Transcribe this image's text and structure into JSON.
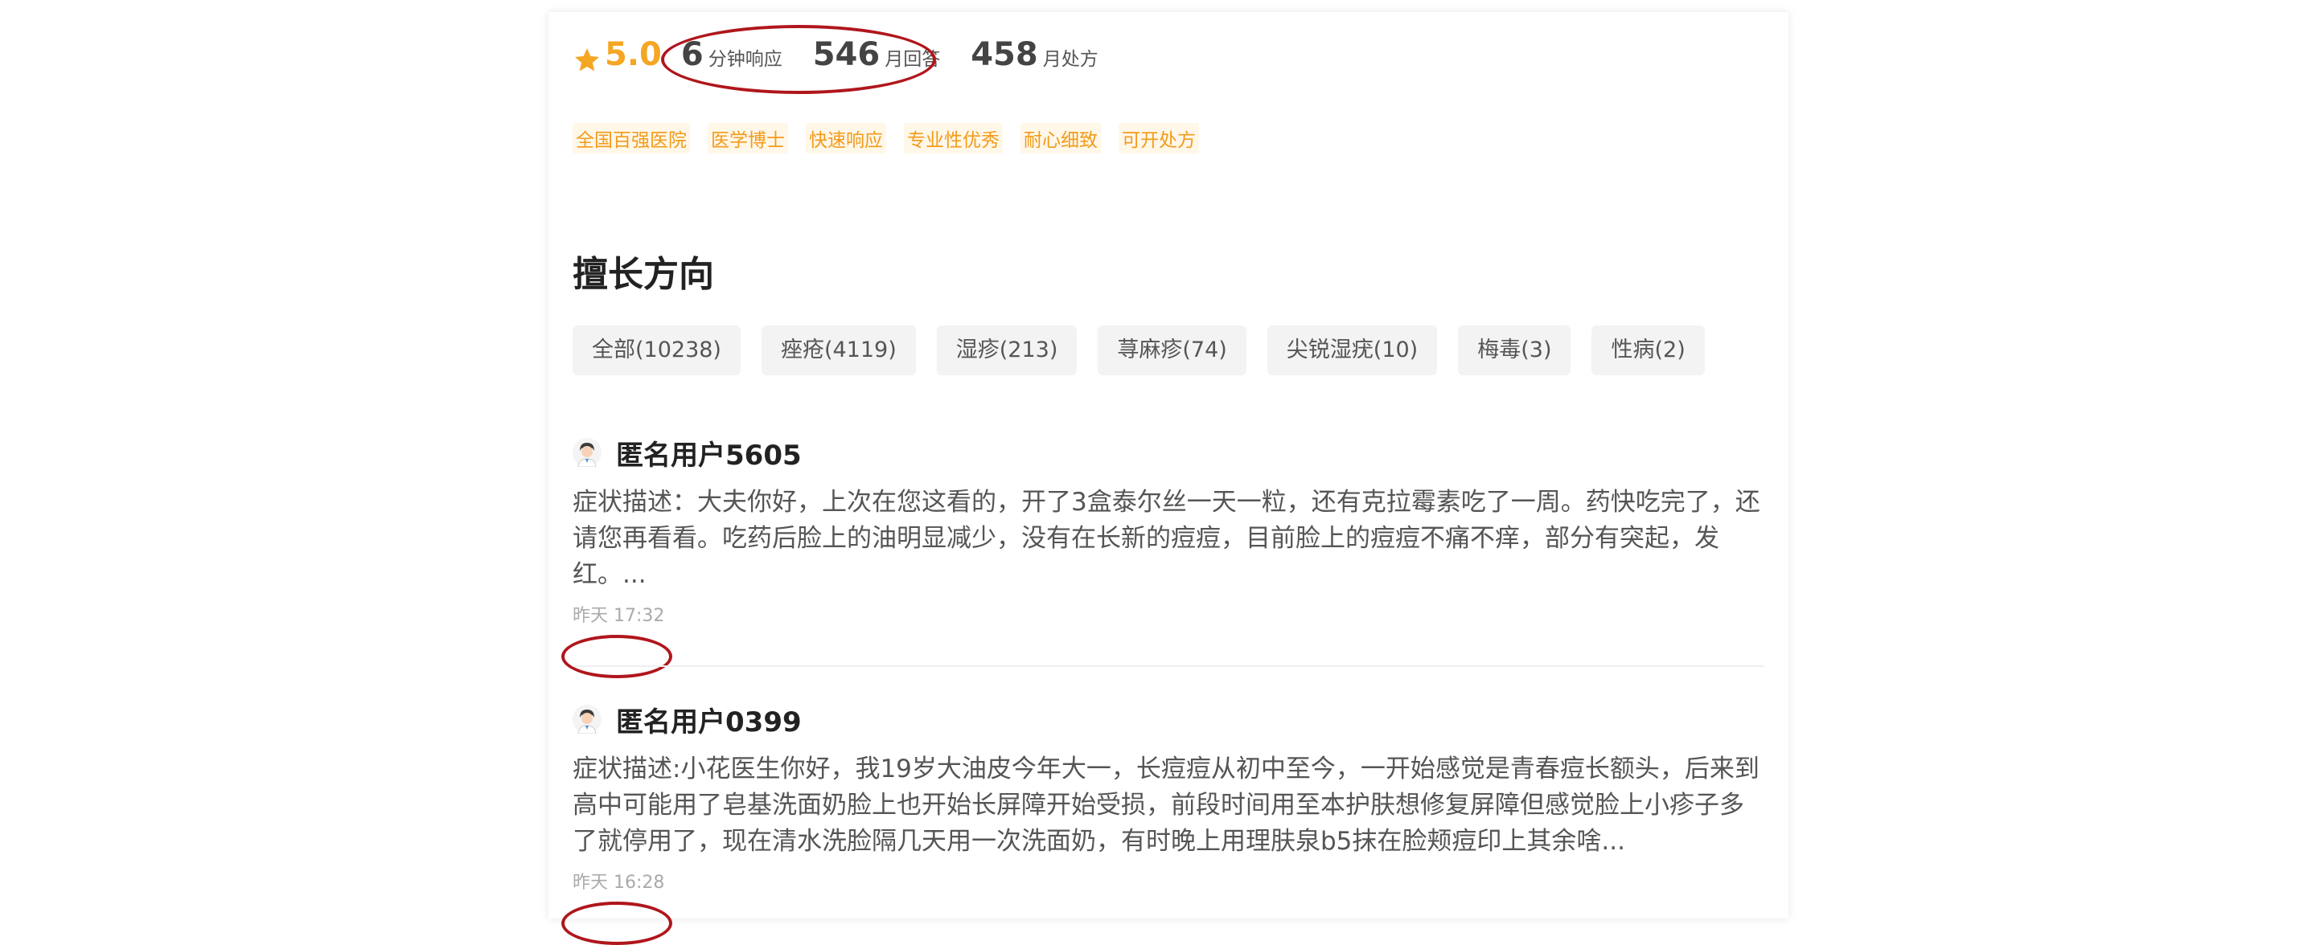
{
  "stats": {
    "rating": "5.0",
    "response_time_value": "6",
    "response_time_unit": "分钟响应",
    "monthly_answers_value": "546",
    "monthly_answers_unit": "月回答",
    "monthly_prescriptions_value": "458",
    "monthly_prescriptions_unit": "月处方"
  },
  "tags": [
    "全国百强医院",
    "医学博士",
    "快速响应",
    "专业性优秀",
    "耐心细致",
    "可开处方"
  ],
  "section": {
    "title": "擅长方向"
  },
  "filters": [
    "全部(10238)",
    "痤疮(4119)",
    "湿疹(213)",
    "荨麻疹(74)",
    "尖锐湿疣(10)",
    "梅毒(3)",
    "性病(2)"
  ],
  "questions": [
    {
      "user": "匿名用户5605",
      "description": "症状描述：大夫你好，上次在您这看的，开了3盒泰尔丝一天一粒，还有克拉霉素吃了一周。药快吃完了，还请您再看看。吃药后脸上的油明显减少，没有在长新的痘痘，目前脸上的痘痘不痛不痒，部分有突起，发红。...",
      "time": "昨天 17:32"
    },
    {
      "user": "匿名用户0399",
      "description": "症状描述:小花医生你好，我19岁大油皮今年大一，长痘痘从初中至今，一开始感觉是青春痘长额头，后来到高中可能用了皂基洗面奶脸上也开始长屏障开始受损，前段时间用至本护肤想修复屏障但感觉脸上小疹子多了就停用了，现在清水洗脸隔几天用一次洗面奶，有时晚上用理肤泉b5抹在脸颊痘印上其余啥...",
      "time": "昨天 16:28"
    }
  ],
  "colors": {
    "accent": "#f5a623",
    "tag_text": "#f29b1a",
    "annotation": "#b0161c"
  },
  "icons": {
    "rating": "star-icon",
    "user": "doctor-avatar-icon"
  }
}
